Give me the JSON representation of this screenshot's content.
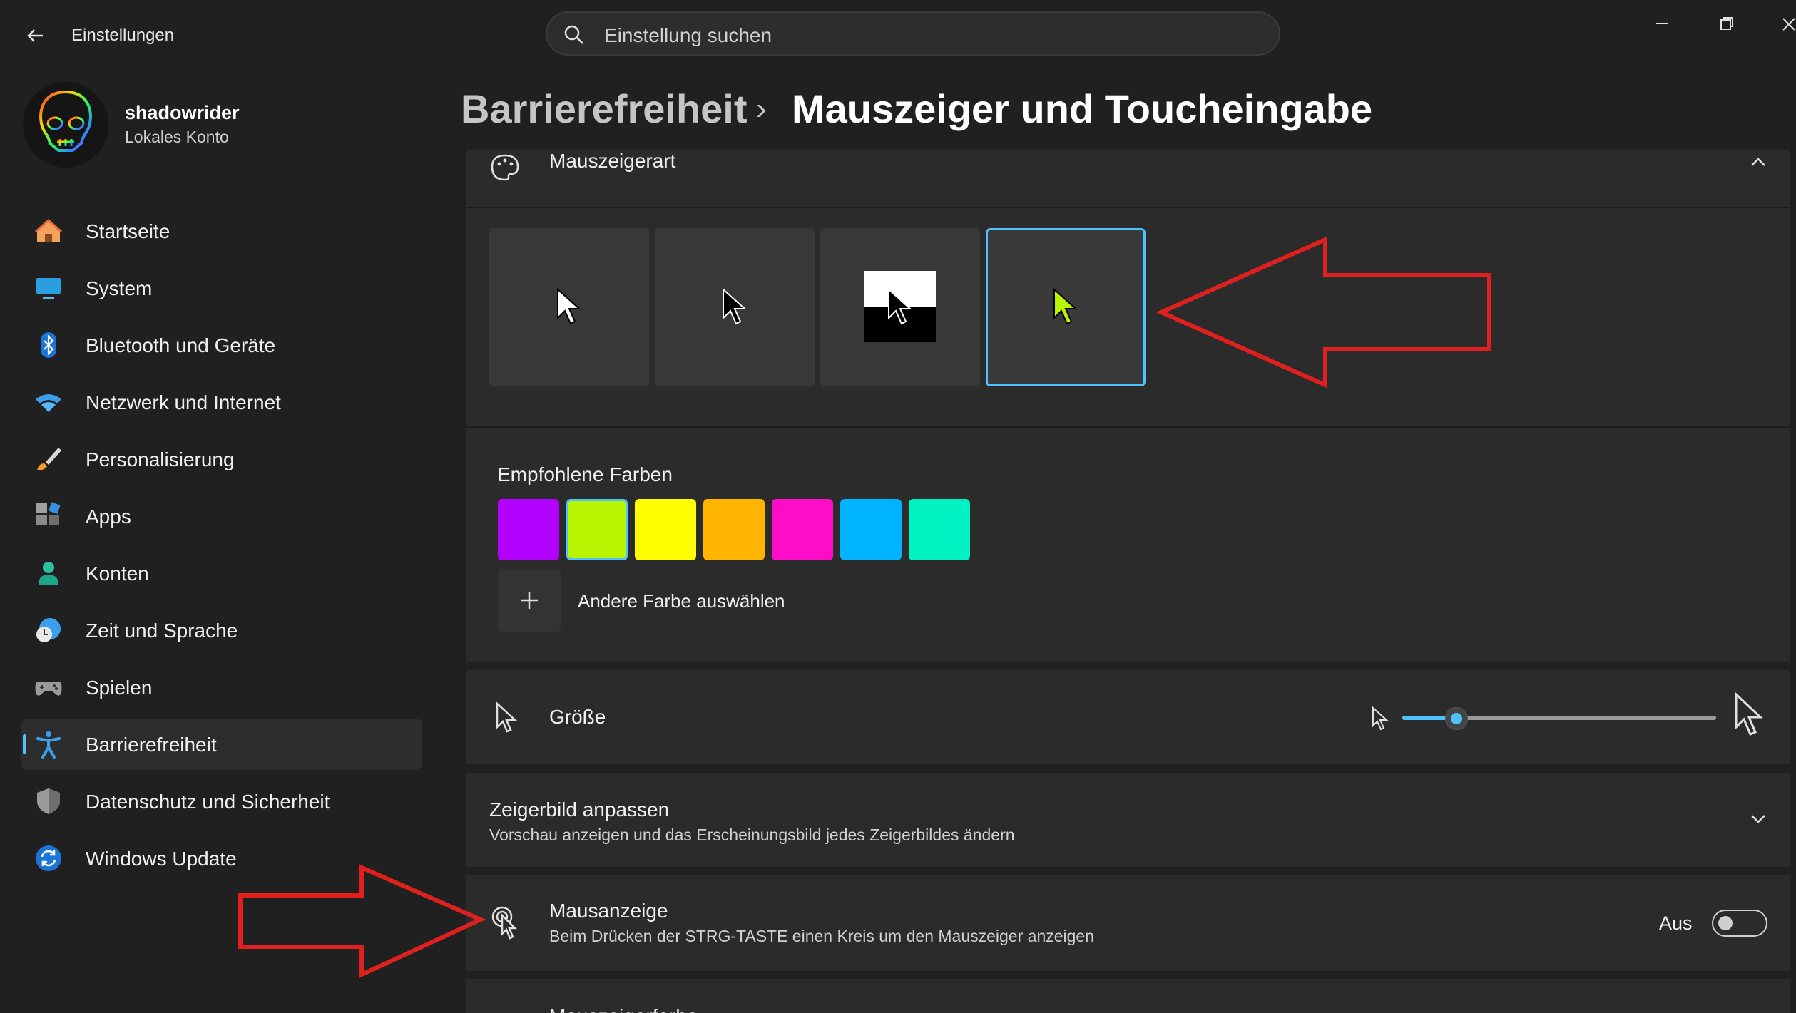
{
  "app": {
    "title": "Einstellungen"
  },
  "search": {
    "placeholder": "Einstellung suchen"
  },
  "user": {
    "name": "shadowrider",
    "account": "Lokales Konto"
  },
  "sidebar": {
    "items": [
      {
        "label": "Startseite",
        "icon": "home-icon"
      },
      {
        "label": "System",
        "icon": "monitor-icon"
      },
      {
        "label": "Bluetooth und Geräte",
        "icon": "bluetooth-icon"
      },
      {
        "label": "Netzwerk und Internet",
        "icon": "wifi-icon"
      },
      {
        "label": "Personalisierung",
        "icon": "brush-icon"
      },
      {
        "label": "Apps",
        "icon": "apps-icon"
      },
      {
        "label": "Konten",
        "icon": "person-icon"
      },
      {
        "label": "Zeit und Sprache",
        "icon": "clock-globe-icon"
      },
      {
        "label": "Spielen",
        "icon": "gamepad-icon"
      },
      {
        "label": "Barrierefreiheit",
        "icon": "accessibility-icon"
      },
      {
        "label": "Datenschutz und Sicherheit",
        "icon": "shield-icon"
      },
      {
        "label": "Windows Update",
        "icon": "update-icon"
      }
    ],
    "active": "Barrierefreiheit"
  },
  "breadcrumb": {
    "parent": "Barrierefreiheit",
    "separator": "›",
    "current": "Mauszeiger und Toucheingabe"
  },
  "pointer_style": {
    "title": "Mauszeigerart",
    "options": [
      "white",
      "black",
      "inverted",
      "custom"
    ],
    "selected": "custom",
    "recommended_title": "Empfohlene Farben",
    "colors": [
      "#b200ff",
      "#b9f400",
      "#ffff00",
      "#ffb400",
      "#ff0cc9",
      "#00b4ff",
      "#00f2c3"
    ],
    "selected_color": "#b9f400",
    "other_color_label": "Andere Farbe auswählen"
  },
  "size": {
    "label": "Größe",
    "value_fraction": 0.17
  },
  "pointer_image": {
    "title": "Zeigerbild anpassen",
    "subtitle": "Vorschau anzeigen und das Erscheinungsbild jedes Zeigerbildes ändern"
  },
  "mouse_indicator": {
    "title": "Mausanzeige",
    "subtitle": "Beim Drücken der STRG-TASTE einen Kreis um den Mauszeiger anzeigen",
    "state": "Aus"
  },
  "next_row": {
    "title": "Mauszeigerfarbe"
  },
  "colors": {
    "accent": "#4cc2ff",
    "arrow": "#e0201e"
  }
}
